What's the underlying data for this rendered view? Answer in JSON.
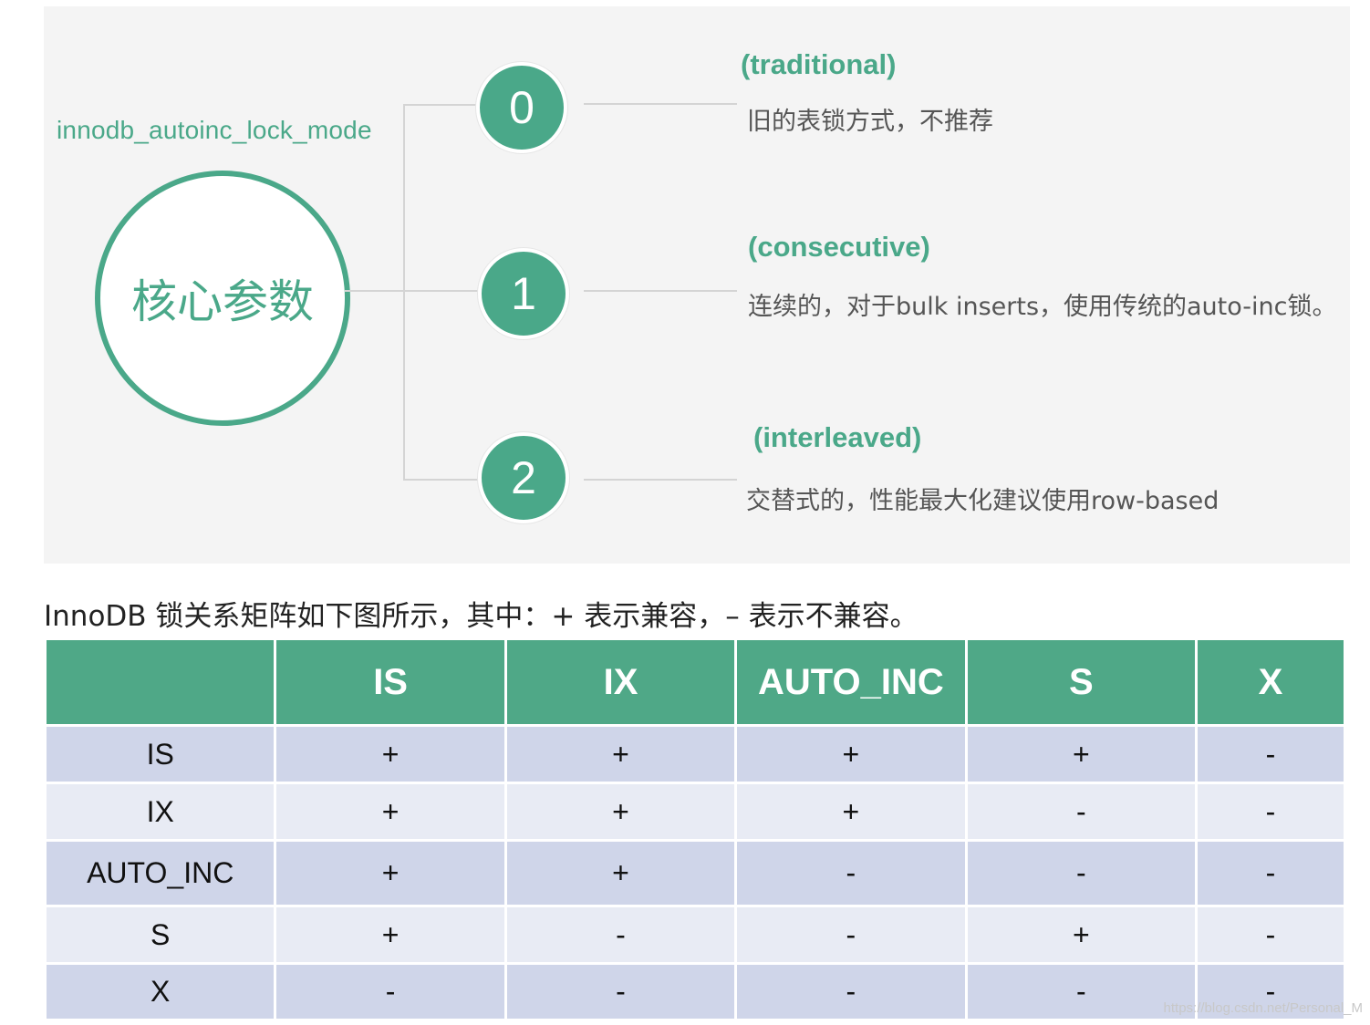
{
  "diagram": {
    "param_label": "innodb_autoinc_lock_mode",
    "core_label": "核心参数",
    "modes": [
      {
        "number": "0",
        "title": "(traditional)",
        "desc": "旧的表锁方式，不推荐"
      },
      {
        "number": "1",
        "title": "(consecutive)",
        "desc": "连续的，对于bulk inserts，使用传统的auto-inc锁。"
      },
      {
        "number": "2",
        "title": "(interleaved)",
        "desc": "交替式的，性能最大化建议使用row-based"
      }
    ],
    "colors": {
      "accent": "#4aa889",
      "background": "#f4f4f4"
    }
  },
  "caption": "InnoDB 锁关系矩阵如下图所示，其中：+ 表示兼容，– 表示不兼容。",
  "matrix": {
    "headers": [
      "",
      "IS",
      "IX",
      "AUTO_INC",
      "S",
      "X"
    ],
    "rows": [
      [
        "IS",
        "+",
        "+",
        "+",
        "+",
        "-"
      ],
      [
        "IX",
        "+",
        "+",
        "+",
        "-",
        "-"
      ],
      [
        "AUTO_INC",
        "+",
        "+",
        "-",
        "-",
        "-"
      ],
      [
        "S",
        "+",
        "-",
        "-",
        "+",
        "-"
      ],
      [
        "X",
        "-",
        "-",
        "-",
        "-",
        "-"
      ]
    ],
    "colors": {
      "header": "#4fa887",
      "row_odd": "#cfd5e9",
      "row_even": "#e8ebf4"
    }
  },
  "watermark": "https://blog.csdn.net/Personal_M"
}
